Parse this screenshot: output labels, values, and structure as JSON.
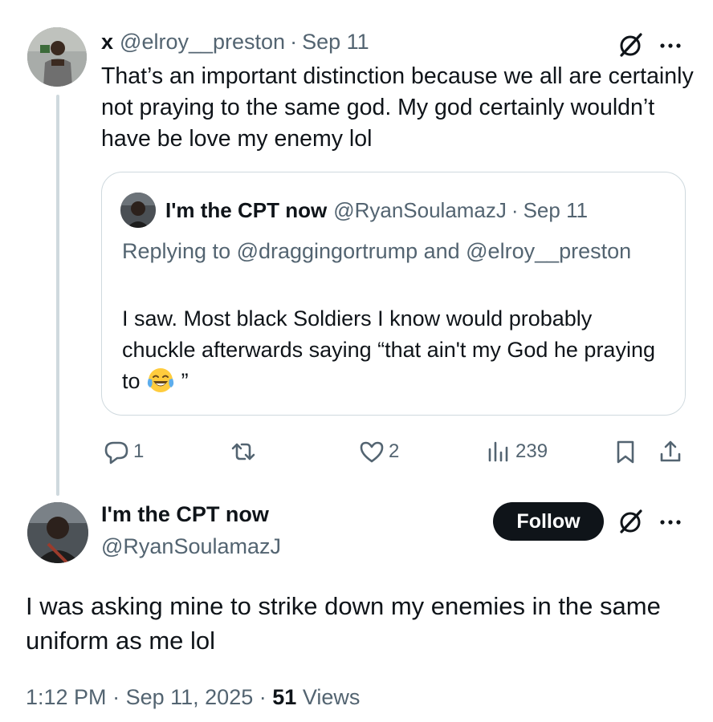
{
  "top_tweet": {
    "display_name": "x",
    "handle": "@elroy__preston",
    "separator": "·",
    "date": "Sep 11",
    "text": "That’s an important distinction because we all are certainly not praying to the same god. My god certainly wouldn’t have be love my enemy lol",
    "quote": {
      "display_name": "I'm the CPT now",
      "handle": "@RyanSoulamazJ",
      "separator": "·",
      "date": "Sep 11",
      "replying_to": "Replying to @draggingortrump and @elroy__preston",
      "text": "I saw. Most black Soldiers I know would probably chuckle afterwards saying “that ain't my God he praying to",
      "text_end_emoji": "face-with-tears-of-joy",
      "text_end": "”"
    },
    "actions": {
      "replies": "1",
      "retweets": "",
      "likes": "2",
      "views": "239"
    }
  },
  "main_tweet": {
    "display_name": "I'm the CPT now",
    "handle": "@RyanSoulamazJ",
    "follow_label": "Follow",
    "text": "I was asking mine to strike down my enemies in the same uniform as me lol",
    "time": "1:12 PM",
    "separator": "·",
    "date": "Sep 11, 2025",
    "separator2": "·",
    "views_count": "51",
    "views_label": "Views"
  },
  "icons": {
    "grok": "grok-slash-circle-icon",
    "more": "more-dots-icon",
    "reply": "reply-bubble-icon",
    "retweet": "retweet-icon",
    "like": "heart-icon",
    "views": "views-bars-icon",
    "bookmark": "bookmark-icon",
    "share": "share-icon"
  },
  "colors": {
    "text": "#0f1419",
    "muted": "#536471",
    "border": "#cfd9de",
    "button": "#0f1419"
  }
}
